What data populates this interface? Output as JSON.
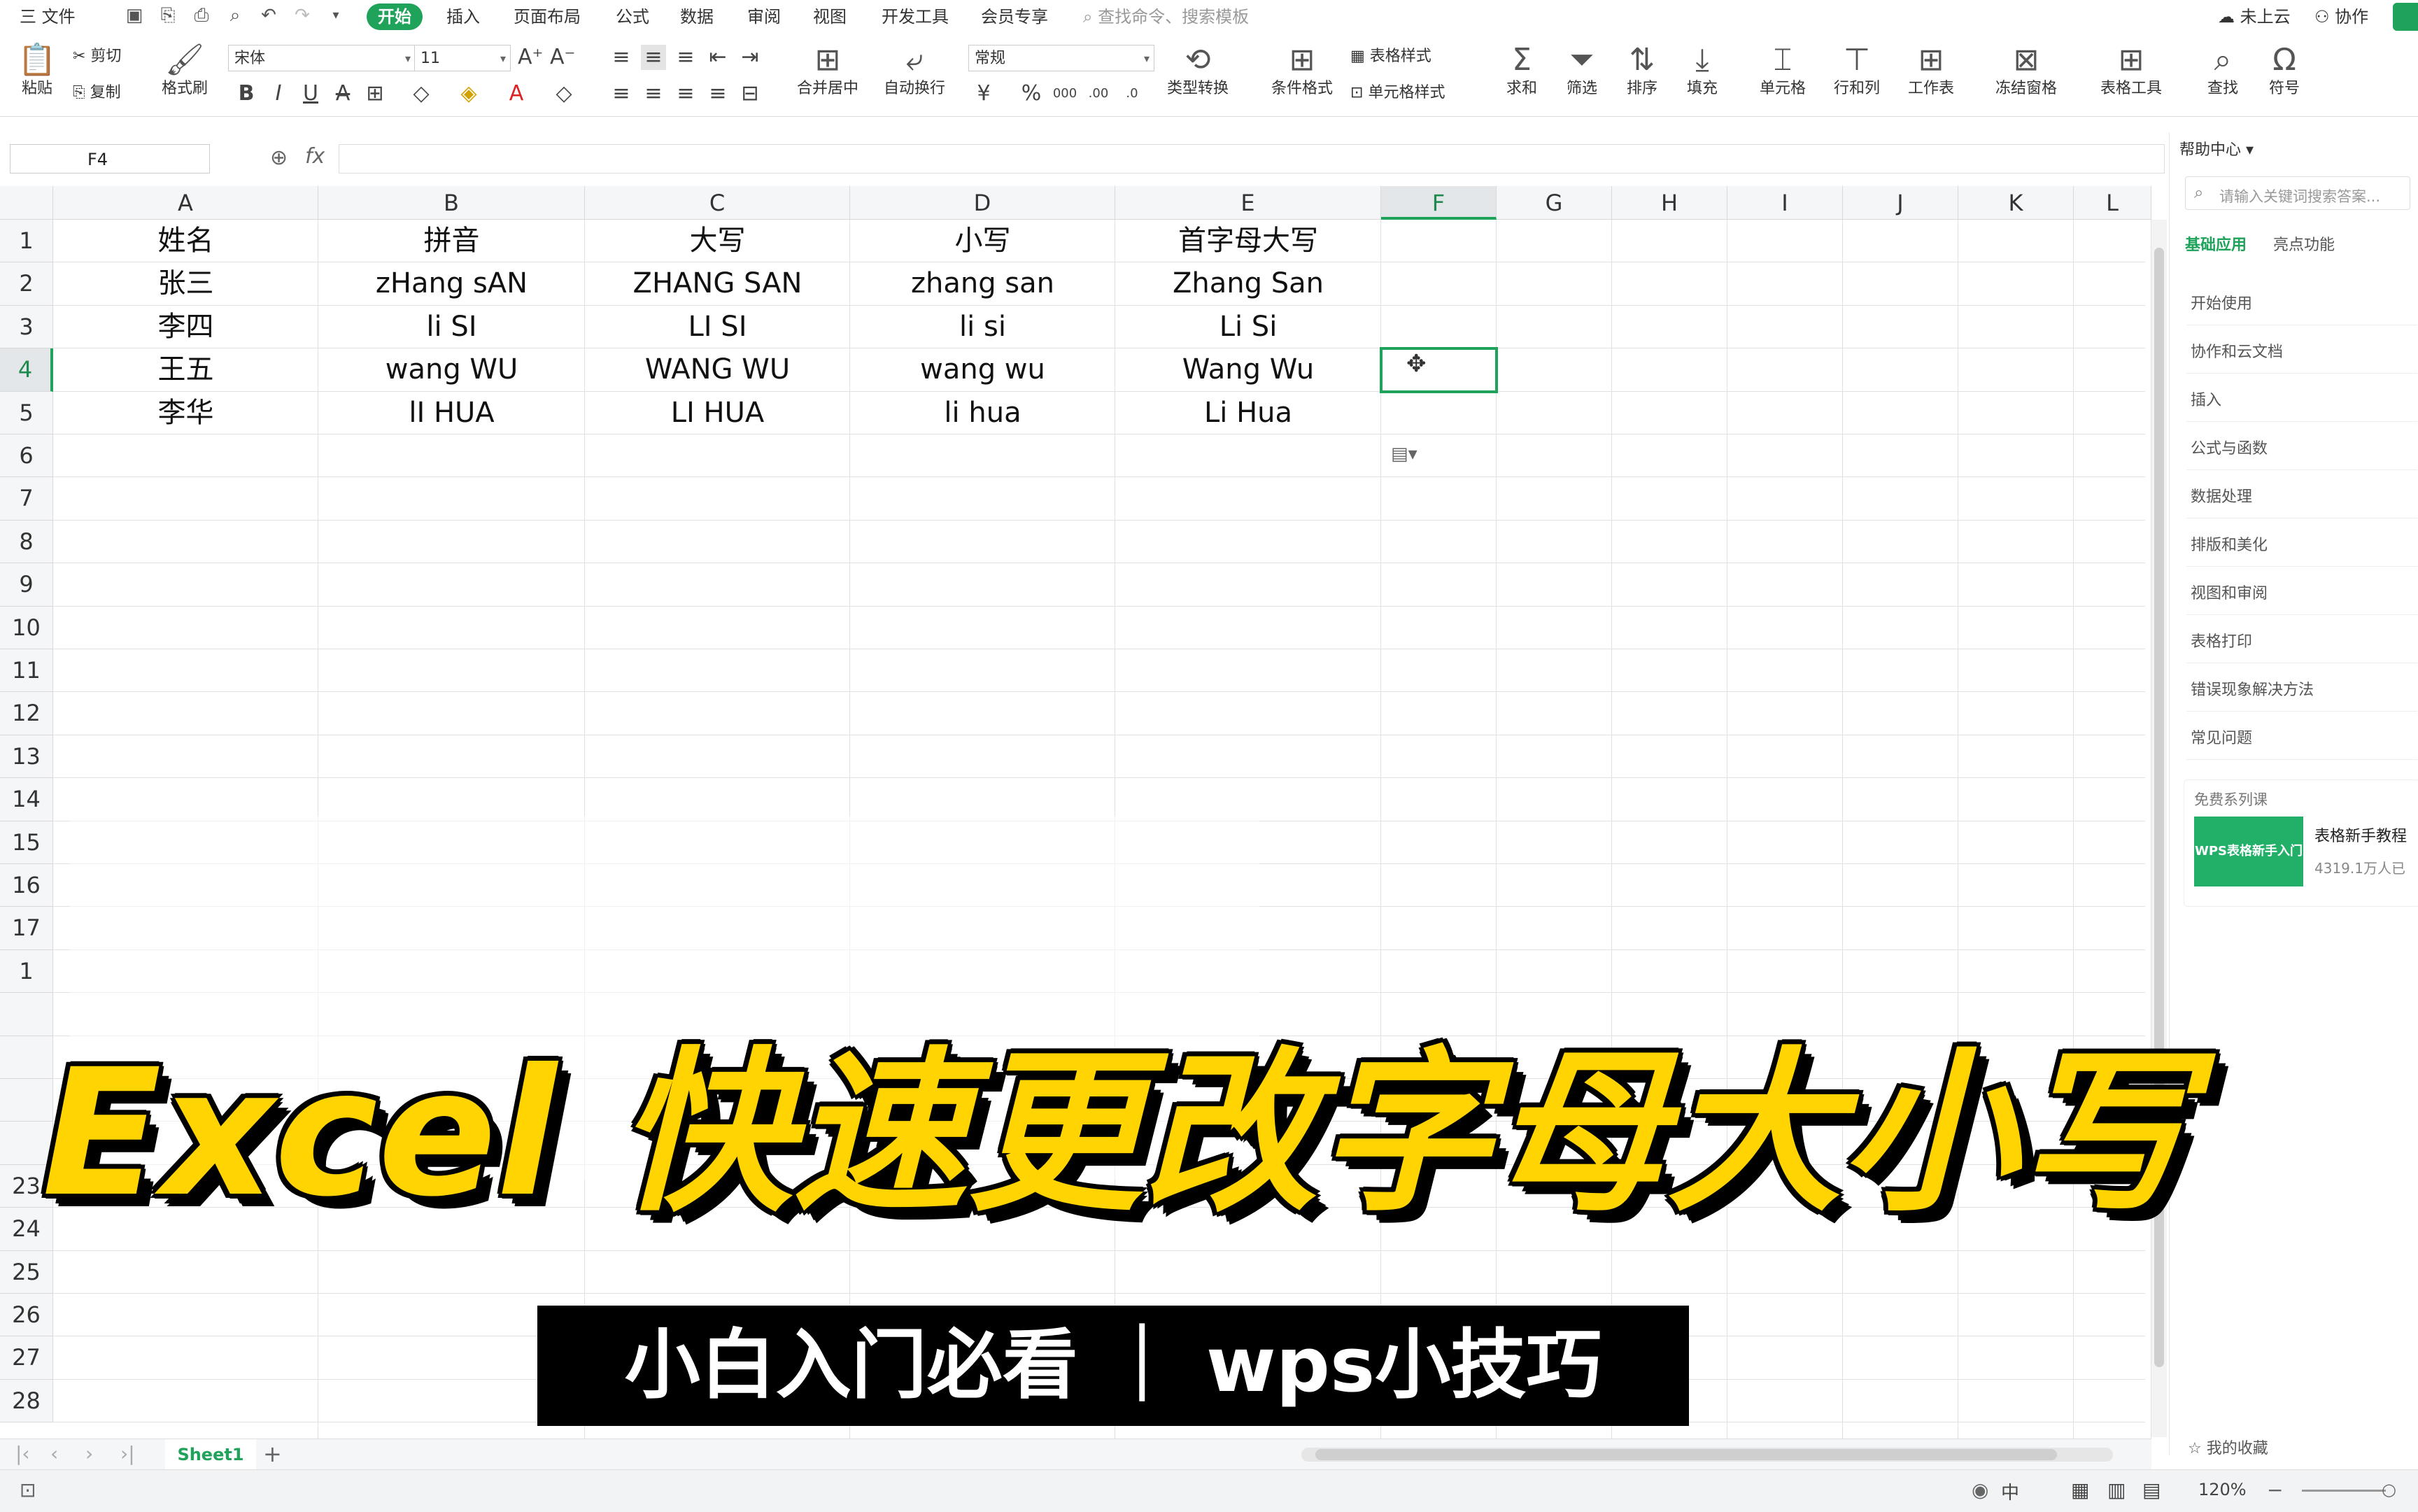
{
  "menubar": {
    "file_label": "三 文件",
    "tabs": [
      "开始",
      "插入",
      "页面布局",
      "公式",
      "数据",
      "审阅",
      "视图",
      "开发工具",
      "会员专享"
    ],
    "search_placeholder": "查找命令、搜索模板",
    "cloud_label": "未上云",
    "collab_label": "协作"
  },
  "ribbon": {
    "paste": "粘贴",
    "cut": "剪切",
    "copy": "复制",
    "format_painter": "格式刷",
    "font_name": "宋体",
    "font_size": "11",
    "merge_center": "合并居中",
    "wrap_text": "自动换行",
    "number_format": "常规",
    "type_convert": "类型转换",
    "cond_format": "条件格式",
    "table_style": "表格样式",
    "cell_style": "单元格样式",
    "sum": "求和",
    "filter": "筛选",
    "sort": "排序",
    "fill": "填充",
    "cell": "单元格",
    "row_col": "行和列",
    "worksheet": "工作表",
    "freeze": "冻结窗格",
    "table_tools": "表格工具",
    "find": "查找",
    "symbol": "符号"
  },
  "formula_bar": {
    "name_box": "F4",
    "fx": "fx",
    "formula": ""
  },
  "grid": {
    "columns": [
      "A",
      "B",
      "C",
      "D",
      "E",
      "F",
      "G",
      "H",
      "I",
      "J",
      "K",
      "L"
    ],
    "rows": [
      "1",
      "2",
      "3",
      "4",
      "5",
      "6",
      "7",
      "8",
      "9",
      "10",
      "11",
      "12",
      "13",
      "14",
      "15",
      "16",
      "17",
      "1",
      "",
      "",
      "",
      "",
      "23",
      "24",
      "25",
      "26",
      "27",
      "28"
    ],
    "selected_cell": "F4",
    "data": [
      [
        "姓名",
        "拼音",
        "大写",
        "小写",
        "首字母大写"
      ],
      [
        "张三",
        "zHang sAN",
        "ZHANG SAN",
        "zhang san",
        "Zhang San"
      ],
      [
        "李四",
        "li SI",
        "LI SI",
        "li si",
        "Li Si"
      ],
      [
        "王五",
        "wang WU",
        "WANG WU",
        "wang wu",
        "Wang Wu"
      ],
      [
        "李华",
        "lI HUA",
        "LI HUA",
        "li hua",
        "Li Hua"
      ]
    ]
  },
  "panel": {
    "header": "帮助中心",
    "search_placeholder": "请输入关键词搜索答案...",
    "tabs": [
      "基础应用",
      "亮点功能"
    ],
    "items": [
      "开始使用",
      "协作和云文档",
      "插入",
      "公式与函数",
      "数据处理",
      "排版和美化",
      "视图和审阅",
      "表格打印",
      "错误现象解决方法",
      "常见问题"
    ],
    "free_course": "免费系列课",
    "course_thumb": "WPS表格新手入门",
    "course_title": "表格新手教程",
    "course_views": "4319.1万人已",
    "favorites": "我的收藏"
  },
  "sheet_tabs": {
    "sheet": "Sheet1",
    "add": "+"
  },
  "status": {
    "zoom": "120%",
    "lang": "中"
  },
  "overlay": {
    "title": "Excel 快速更改字母大小写",
    "subtitle": "小白入门必看 ｜ wps小技巧"
  },
  "colors": {
    "accent": "#1fa25a",
    "title_yellow": "#ffd400"
  }
}
